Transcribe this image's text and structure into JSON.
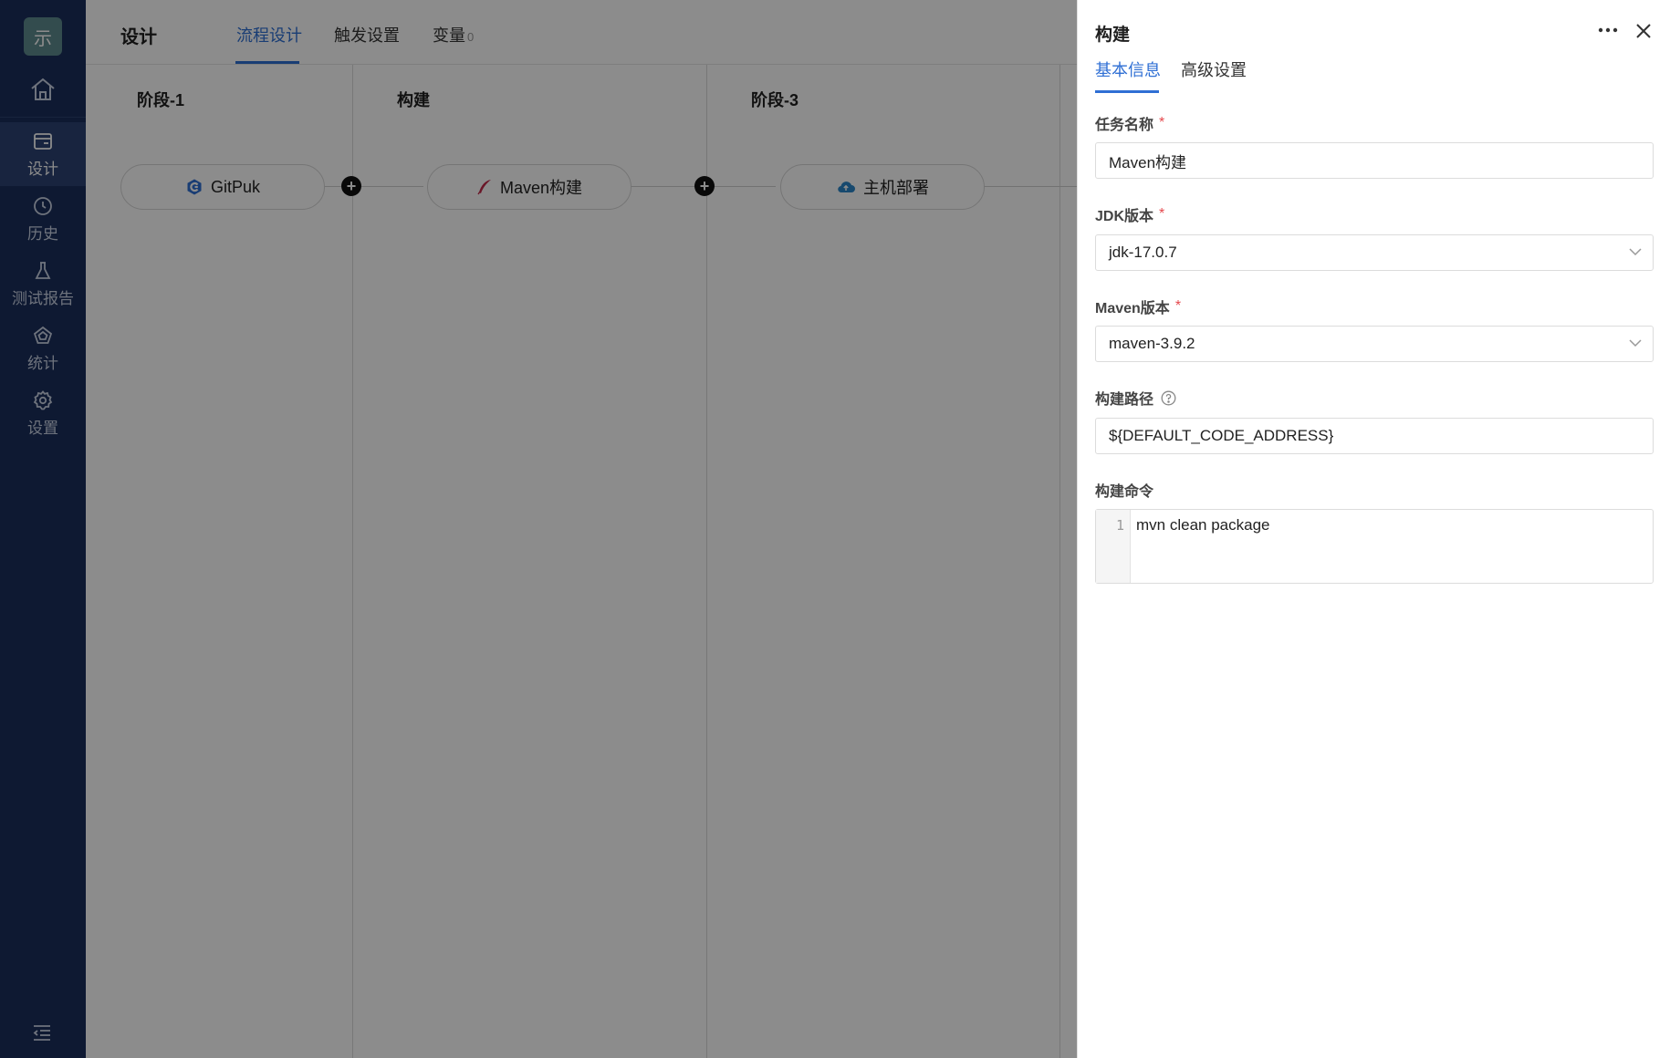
{
  "sidebar": {
    "logo_text": "示",
    "items": [
      {
        "label": "设计",
        "icon": "design-icon",
        "active": true
      },
      {
        "label": "历史",
        "icon": "history-clock-icon",
        "active": false
      },
      {
        "label": "测试报告",
        "icon": "test-flask-icon",
        "active": false
      },
      {
        "label": "统计",
        "icon": "stats-icon",
        "active": false
      },
      {
        "label": "设置",
        "icon": "settings-gear-icon",
        "active": false
      }
    ]
  },
  "header": {
    "title": "设计",
    "tabs": [
      {
        "label": "流程设计",
        "active": true
      },
      {
        "label": "触发设置",
        "active": false
      },
      {
        "label": "变量",
        "count": "0",
        "active": false
      }
    ]
  },
  "pipeline": {
    "stages": [
      {
        "title": "阶段-1",
        "task": "GitPuk",
        "icon": "gitpuk-icon"
      },
      {
        "title": "构建",
        "task": "Maven构建",
        "icon": "maven-feather-icon"
      },
      {
        "title": "阶段-3",
        "task": "主机部署",
        "icon": "cloud-deploy-icon"
      }
    ]
  },
  "drawer": {
    "title": "构建",
    "tabs": [
      {
        "label": "基本信息",
        "active": true
      },
      {
        "label": "高级设置",
        "active": false
      }
    ],
    "fields": {
      "task_name": {
        "label": "任务名称",
        "required": true,
        "value": "Maven构建"
      },
      "jdk_version": {
        "label": "JDK版本",
        "required": true,
        "value": "jdk-17.0.7"
      },
      "maven_version": {
        "label": "Maven版本",
        "required": true,
        "value": "maven-3.9.2"
      },
      "build_path": {
        "label": "构建路径",
        "value": "${DEFAULT_CODE_ADDRESS}"
      },
      "build_command": {
        "label": "构建命令",
        "line_number": "1",
        "value": "mvn clean package"
      }
    }
  },
  "colors": {
    "sidebar_bg": "#1b2f5c",
    "accent": "#2f6fd4",
    "required": "#e5484d"
  }
}
